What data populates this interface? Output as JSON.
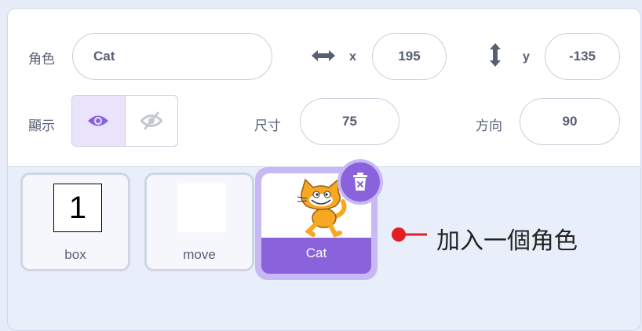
{
  "info_panel": {
    "sprite_label": "角色",
    "sprite_name": "Cat",
    "x_label": "x",
    "x_value": "195",
    "y_label": "y",
    "y_value": "-135",
    "show_label": "顯示",
    "size_label": "尺寸",
    "size_value": "75",
    "direction_label": "方向",
    "direction_value": "90"
  },
  "sprites": [
    {
      "name": "box",
      "thumb_text": "1"
    },
    {
      "name": "move",
      "thumb_text": ""
    },
    {
      "name": "Cat",
      "selected": true
    }
  ],
  "annotation": {
    "text": "加入一個角色",
    "color": "#e31e24"
  },
  "colors": {
    "accent": "#8a63dc",
    "accent_light": "#c8b9f4",
    "text": "#575e75"
  },
  "icons": [
    "horizontal-arrows-icon",
    "vertical-arrows-icon",
    "eye-icon",
    "eye-slash-icon",
    "trash-icon"
  ]
}
